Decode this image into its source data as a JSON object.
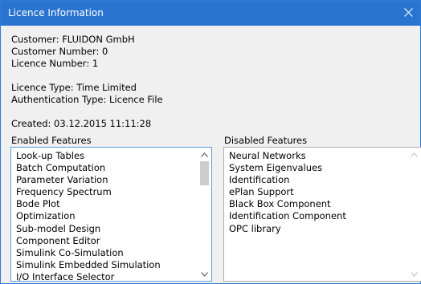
{
  "window": {
    "title": "Licence Information",
    "close_icon": "close-icon"
  },
  "info": {
    "customer": "Customer: FLUIDON GmbH",
    "customer_number": "Customer Number: 0",
    "licence_number": "Licence Number: 1",
    "licence_type": "Licence Type: Time Limited",
    "authentication_type": "Authentication Type: Licence File",
    "created": "Created: 03.12.2015 11:11:28"
  },
  "enabled_features": {
    "label": "Enabled Features",
    "items": [
      "Look-up Tables",
      "Batch Computation",
      "Parameter Variation",
      "Frequency Spectrum",
      "Bode Plot",
      "Optimization",
      "Sub-model Design",
      "Component Editor",
      "Simulink Co-Simulation",
      "Simulink Embedded Simulation",
      "I/O Interface Selector"
    ]
  },
  "disabled_features": {
    "label": "Disabled Features",
    "items": [
      "Neural Networks",
      "System Eigenvalues",
      "Identification",
      "ePlan Support",
      "Black Box Component",
      "Identification Component",
      "OPC library"
    ]
  },
  "colors": {
    "titlebar": "#2a74d1",
    "window_bg": "#f0f0f0",
    "enabled_border": "#5d9bd6",
    "disabled_border": "#aeaeae"
  }
}
